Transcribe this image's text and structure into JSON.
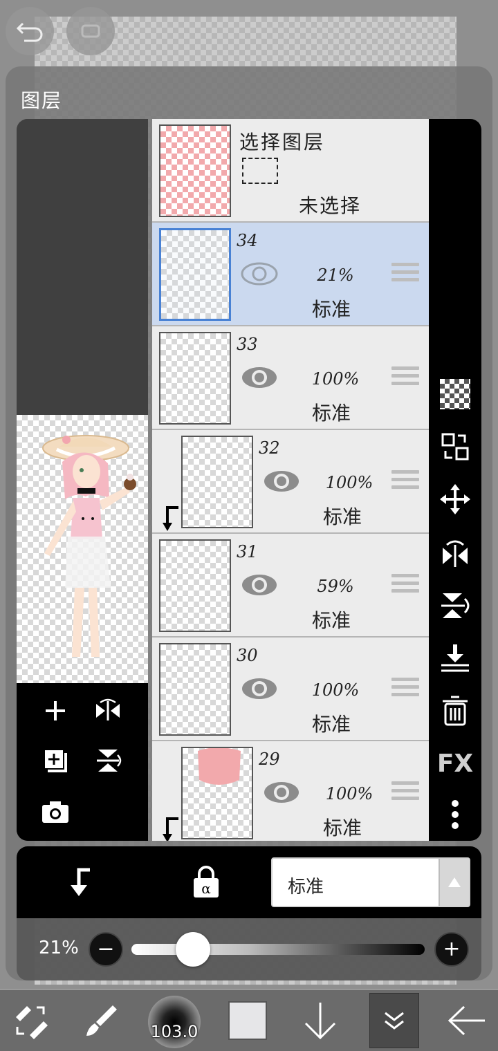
{
  "panel": {
    "title": "图层"
  },
  "select_layer_row": {
    "title": "选择图层",
    "status": "未选择"
  },
  "layers": [
    {
      "number": "34",
      "opacity": "21%",
      "blend": "标准",
      "selected": true,
      "clipped": false
    },
    {
      "number": "33",
      "opacity": "100%",
      "blend": "标准",
      "selected": false,
      "clipped": false
    },
    {
      "number": "32",
      "opacity": "100%",
      "blend": "标准",
      "selected": false,
      "clipped": true
    },
    {
      "number": "31",
      "opacity": "59%",
      "blend": "标准",
      "selected": false,
      "clipped": false
    },
    {
      "number": "30",
      "opacity": "100%",
      "blend": "标准",
      "selected": false,
      "clipped": false
    },
    {
      "number": "29",
      "opacity": "100%",
      "blend": "标准",
      "selected": false,
      "clipped": true
    }
  ],
  "right_toolbar": {
    "fx_label": "FX"
  },
  "bottom_bar": {
    "blend_mode_value": "标准"
  },
  "opacity_slider": {
    "label": "21%",
    "value": 0.21
  },
  "toolbar": {
    "brush_size": "103.0"
  },
  "colors": {
    "selected_row": "#cbd9ef",
    "selected_border": "#3a78d2",
    "primary_color": "#e6e6e8"
  }
}
